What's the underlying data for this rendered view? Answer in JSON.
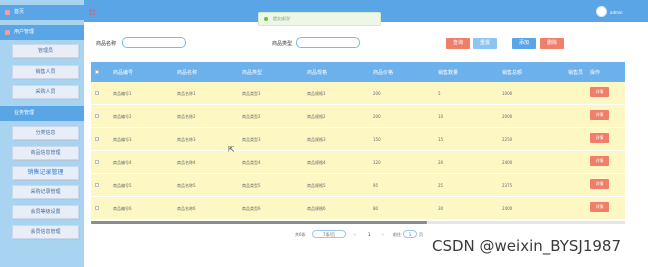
{
  "sidebar": {
    "home": "首页",
    "user_mgmt": "用户管理",
    "user_items": [
      "管理员",
      "销售人员",
      "采购人员"
    ],
    "business_mgmt": "业务管理",
    "business_items": [
      "分类信息",
      "商品信息管理",
      "销售记录管理",
      "采购记录管理",
      "会员等级设置",
      "会员信息管理"
    ],
    "active_item": "销售记录管理"
  },
  "topbar": {
    "username": "admin",
    "avatar_color": "#ffffff",
    "bar_color": "#5aa5e6"
  },
  "toast": {
    "message": "提交成功!",
    "color": "#67c23a"
  },
  "search": {
    "name_label": "商品名称",
    "type_label": "商品类型",
    "name_value": "",
    "type_value": ""
  },
  "buttons": {
    "query": "查询",
    "reset": "重置",
    "add": "添加",
    "delete": "删除",
    "detail": "详情"
  },
  "table": {
    "columns": [
      "商品编号",
      "商品名称",
      "商品类型",
      "商品规格",
      "商品价格",
      "销售数量",
      "销售总额",
      "销售员",
      "操作"
    ],
    "rows": [
      [
        "商品编号1",
        "商品名称1",
        "商品类型1",
        "商品规格1",
        "200",
        "5",
        "1000",
        ""
      ],
      [
        "商品编号2",
        "商品名称2",
        "商品类型2",
        "商品规格2",
        "200",
        "10",
        "2000",
        ""
      ],
      [
        "商品编号3",
        "商品名称3",
        "商品类型3",
        "商品规格3",
        "150",
        "15",
        "2250",
        ""
      ],
      [
        "商品编号4",
        "商品名称4",
        "商品类型4",
        "商品规格4",
        "120",
        "20",
        "2400",
        ""
      ],
      [
        "商品编号5",
        "商品名称5",
        "商品类型5",
        "商品规格5",
        "95",
        "25",
        "2375",
        ""
      ],
      [
        "商品编号6",
        "商品名称6",
        "商品类型6",
        "商品规格6",
        "80",
        "30",
        "2400",
        ""
      ]
    ],
    "scroll_fraction": 0.63
  },
  "pager": {
    "total": "共6条",
    "page_size": "7条/页",
    "prev": "<",
    "current": "1",
    "next": ">",
    "goto": "前往",
    "goto_value": "1",
    "page_unit": "页"
  },
  "watermark": "CSDN @weixin_BYSJ1987"
}
